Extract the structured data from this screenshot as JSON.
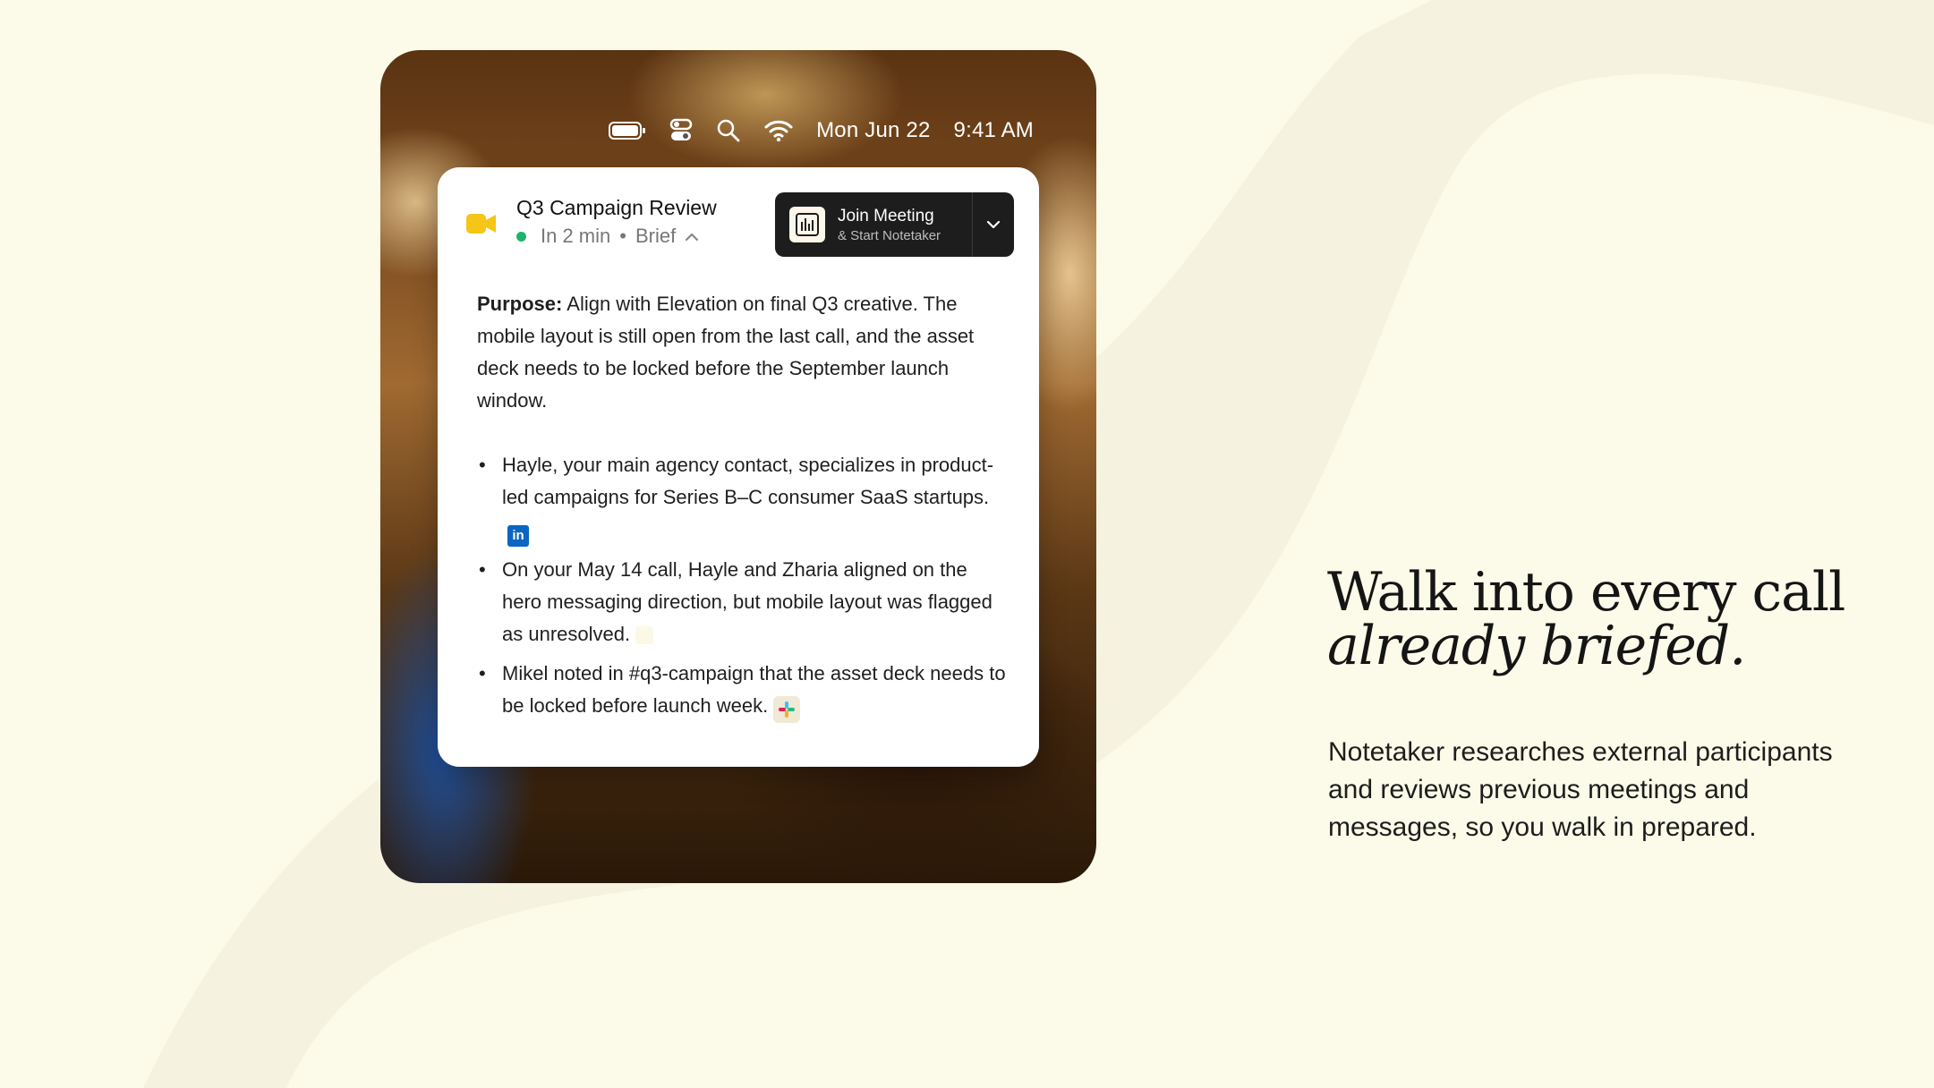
{
  "menubar": {
    "icons": [
      "battery-icon",
      "control-center-icon",
      "search-icon",
      "wifi-icon"
    ],
    "date": "Mon Jun 22",
    "time": "9:41 AM"
  },
  "notification": {
    "title": "Q3 Campaign Review",
    "status_time": "In 2 min",
    "separator": "•",
    "brief_label": "Brief",
    "join_button": {
      "label": "Join Meeting",
      "sublabel": "& Start Notetaker"
    },
    "purpose_label": "Purpose:",
    "purpose_text": "Align with Elevation on final Q3 creative. The mobile layout is still open from the last call, and the asset deck needs to be locked before the September launch window.",
    "bullets": [
      {
        "text": "Hayle, your main agency contact, specializes in product-led campaigns for Series B–C consumer SaaS startups.",
        "source_icon": "linkedin-icon"
      },
      {
        "text": "On your May 14 call, Hayle and Zharia aligned on the hero messaging direction, but mobile layout was flagged as unresolved.",
        "source_icon": "notetaker-icon"
      },
      {
        "text": "Mikel noted in #q3-campaign that the asset deck needs to be locked before launch week.",
        "source_icon": "slack-icon"
      }
    ],
    "linkedin_glyph": "in",
    "colors": {
      "status_dot": "#1db36b",
      "camera": "#f5c518",
      "linkedin": "#0a66c2"
    }
  },
  "hero": {
    "headline_line1": "Walk into every call",
    "headline_line2": "already briefed.",
    "description": "Notetaker researches external participants and reviews previous meetings and messages, so you walk in prepared."
  }
}
